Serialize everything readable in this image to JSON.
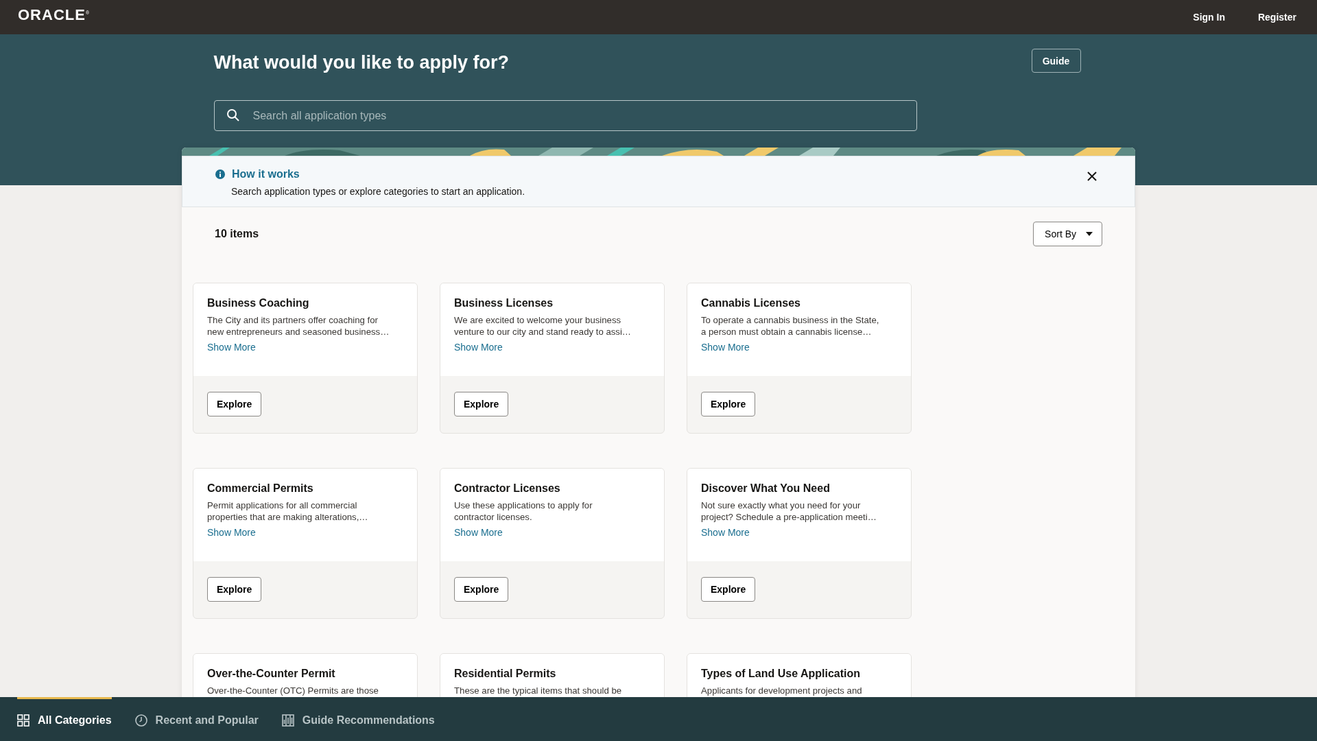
{
  "header": {
    "logo": "ORACLE$^{®}$",
    "links": [
      "Sign In",
      "Register"
    ]
  },
  "hero": {
    "title": "What would you like to apply for?",
    "guide_button": "Guide",
    "search": {
      "placeholder": "Search all application types"
    }
  },
  "notice": {
    "title": "How it works",
    "text": "Search application types or explore categories to start an application."
  },
  "results": {
    "count": "10 items",
    "sort_button": "Sort By"
  },
  "cards": [
    {
      "title": "Business Coaching",
      "description": [
        "The City and its partners offer coaching for",
        "new entrepreneurs and seasoned business…"
      ],
      "link": "Show More",
      "button": "Explore"
    },
    {
      "title": "Business Licenses",
      "description": [
        "We are excited to welcome your business",
        "venture to our city and stand ready to assi…"
      ],
      "link": "Show More",
      "button": "Explore"
    },
    {
      "title": "Cannabis Licenses",
      "description": [
        "To operate a cannabis business in the State,",
        "a person must obtain a cannabis license…"
      ],
      "link": "Show More",
      "button": "Explore"
    },
    {
      "title": "Commercial Permits",
      "description": [
        "Permit applications for all commercial",
        "properties that are making alterations,…"
      ],
      "link": "Show More",
      "button": "Explore"
    },
    {
      "title": "Contractor Licenses",
      "description": [
        "Use these applications to apply for",
        "contractor licenses."
      ],
      "link": "Show More",
      "button": "Explore"
    },
    {
      "title": "Discover What You Need",
      "description": [
        "Not sure exactly what you need for your",
        "project? Schedule a pre-application meeti…"
      ],
      "link": "Show More",
      "button": "Explore"
    },
    {
      "title": "Over-the-Counter Permit",
      "description": [
        "Over-the-Counter (OTC) Permits are those"
      ]
    },
    {
      "title": "Residential Permits",
      "description": [
        "These are the typical items that should be"
      ]
    },
    {
      "title": "Types of Land Use Application",
      "description": [
        "Applicants for development projects and"
      ]
    }
  ],
  "bottom_tabs": [
    {
      "label": "All Categories",
      "kind": "grid",
      "selected": true
    },
    {
      "label": "Recent and Popular",
      "kind": "clock",
      "selected": false
    },
    {
      "label": "Guide Recommendations",
      "kind": "columns",
      "selected": false
    }
  ]
}
